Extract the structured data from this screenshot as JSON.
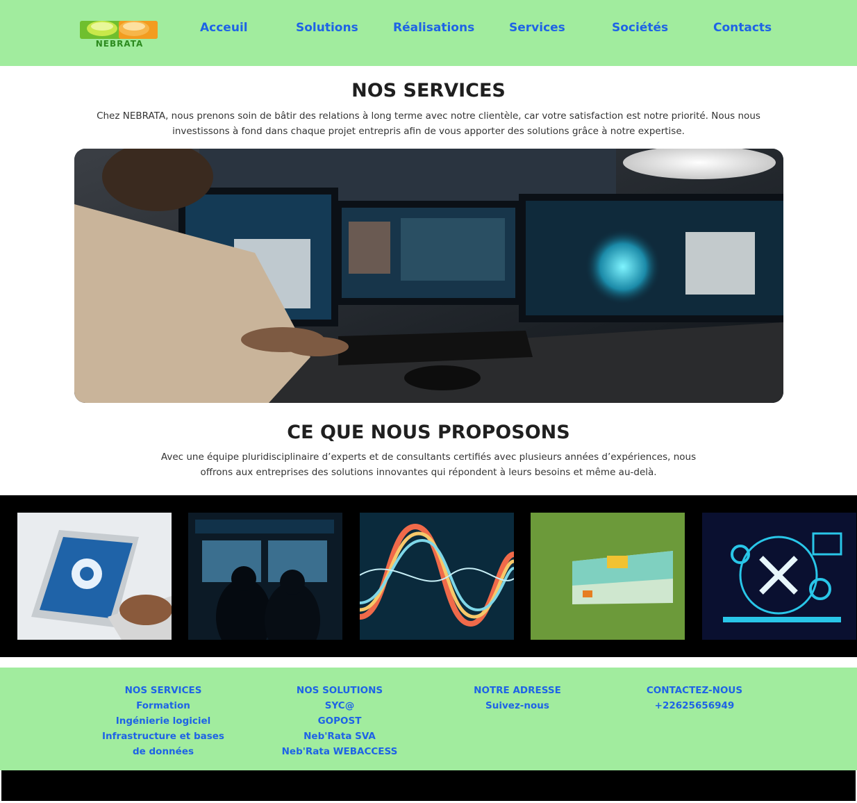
{
  "brand": {
    "logo_text": "NEBRATA",
    "accent": "#1e63e6",
    "header_bg": "#a1ec9e"
  },
  "nav": {
    "items": [
      {
        "label": "Acceuil"
      },
      {
        "label": "Solutions"
      },
      {
        "label": "Réalisations"
      },
      {
        "label": "Services"
      },
      {
        "label": "Sociétés"
      },
      {
        "label": "Contacts"
      }
    ]
  },
  "services": {
    "title": "NOS SERVICES",
    "intro": "Chez NEBRATA, nous prenons soin de bâtir des relations à long terme avec notre clientèle, car votre satisfaction est notre priorité. Nous nous investissons à fond dans chaque projet entrepris afin de vous apporter des solutions grâce à notre expertise.",
    "hero_icon": "workstation-photo"
  },
  "offer": {
    "title": "CE QUE NOUS PROPOSONS",
    "intro": "Avec une équipe pluridisciplinaire d’experts et de consultants certifiés avec plusieurs années d’expériences, nous offrons aux entreprises des solutions innovantes qui répondent à leurs besoins et même au-delà."
  },
  "gallery": {
    "items": [
      {
        "icon": "laptop-update-photo"
      },
      {
        "icon": "monitoring-room-photo"
      },
      {
        "icon": "data-wave-photo"
      },
      {
        "icon": "projection-slide-photo"
      },
      {
        "icon": "maintenance-repair-photo"
      }
    ]
  },
  "footer": {
    "services": {
      "heading": "NOS SERVICES",
      "items": [
        "Formation",
        "Ingénierie logiciel",
        "Infrastructure et bases de données"
      ]
    },
    "solutions": {
      "heading": "NOS SOLUTIONS",
      "items": [
        "SYC@",
        "GOPOST",
        "Neb'Rata SVA",
        "Neb'Rata WEBACCESS"
      ]
    },
    "address": {
      "heading": "NOTRE ADRESSE",
      "link": "Suivez-nous"
    },
    "contact": {
      "heading": "CONTACTEZ-NOUS",
      "phone": "+22625656949"
    }
  }
}
